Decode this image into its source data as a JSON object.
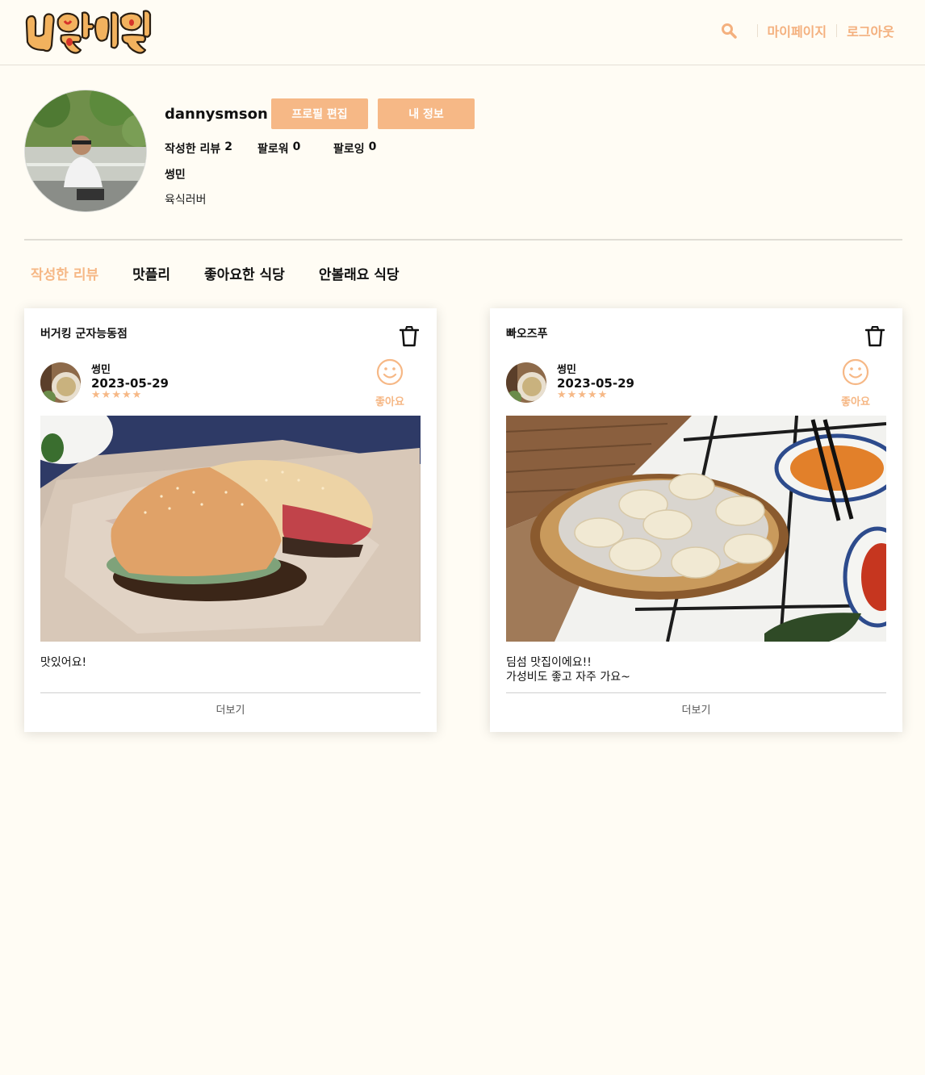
{
  "header": {
    "logo_text": "니맛내맛",
    "search_icon": "search-icon",
    "nav": {
      "mypage": "마이페이지",
      "logout": "로그아웃"
    }
  },
  "profile": {
    "username": "dannysmson",
    "edit_button": "프로필 편집",
    "info_button": "내 정보",
    "stats": {
      "reviews_label": "작성한 리뷰",
      "reviews_count": "2",
      "followers_label": "팔로워",
      "followers_count": "0",
      "following_label": "팔로잉",
      "following_count": "0"
    },
    "nickname": "썽민",
    "bio": "육식러버"
  },
  "tabs": [
    "작성한 리뷰",
    "맛플리",
    "좋아요한 식당",
    "안볼래요 식당"
  ],
  "active_tab": 0,
  "reviews": [
    {
      "restaurant": "버거킹 군자능동점",
      "author": "썽민",
      "date": "2023-05-29",
      "rating": 5,
      "like_label": "좋아요",
      "text": "맛있어요!",
      "more_label": "더보기"
    },
    {
      "restaurant": "빠오즈푸",
      "author": "썽민",
      "date": "2023-05-29",
      "rating": 5,
      "like_label": "좋아요",
      "text": "딤섬 맛집이에요!!\n가성비도 좋고 자주 가요~",
      "more_label": "더보기"
    }
  ],
  "colors": {
    "accent": "#f6b886",
    "background": "#fffcf4"
  }
}
